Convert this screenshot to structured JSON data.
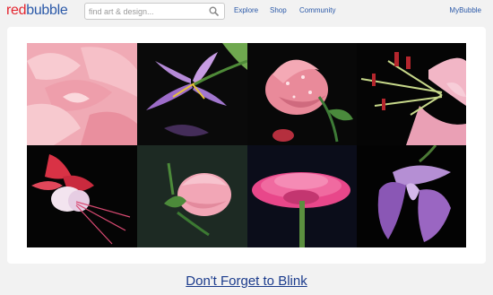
{
  "header": {
    "logo_part1": "red",
    "logo_part2": "bubble",
    "search_placeholder": "find art & design...",
    "nav": [
      {
        "label": "Explore"
      },
      {
        "label": "Shop"
      },
      {
        "label": "Community"
      }
    ],
    "account_label": "MyBubble"
  },
  "artwork": {
    "title": "Don't Forget to Blink",
    "tiles": [
      {
        "subject": "pink carnation petals",
        "bg": "#f3b4bd"
      },
      {
        "subject": "purple lily with reflection",
        "bg": "#0a0a0a"
      },
      {
        "subject": "pink rose with water drops",
        "bg": "#080808"
      },
      {
        "subject": "pink lily stamens",
        "bg": "#050505"
      },
      {
        "subject": "fuchsia flower",
        "bg": "#050505"
      },
      {
        "subject": "pink rose bud",
        "bg": "#1b2620"
      },
      {
        "subject": "pink gerbera daisy",
        "bg": "#090b18"
      },
      {
        "subject": "purple sweet pea",
        "bg": "#030303"
      }
    ]
  },
  "colors": {
    "brand_red": "#e4252f",
    "brand_blue": "#2b59a8",
    "link_blue": "#1b3b8c",
    "page_bg": "#f2f2f2"
  }
}
